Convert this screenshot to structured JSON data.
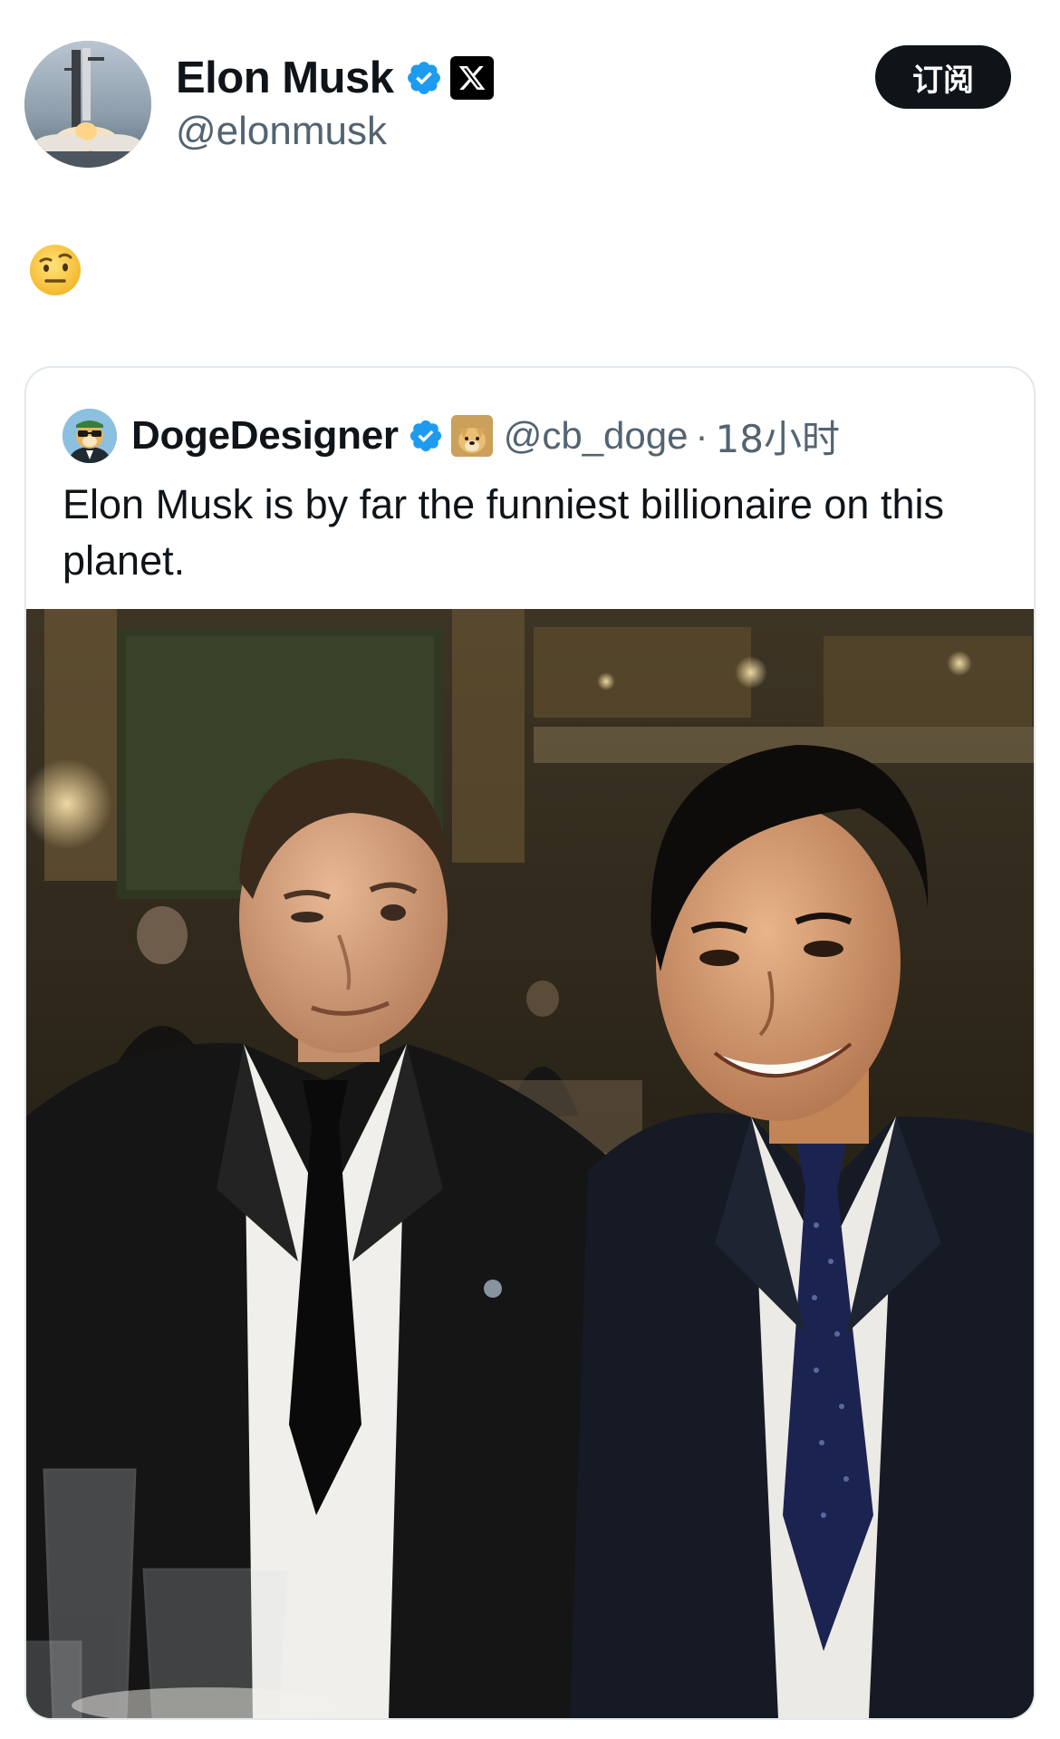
{
  "author": {
    "display_name": "Elon Musk",
    "handle": "@elonmusk",
    "avatar_icon": "rocket-launch-avatar",
    "verified_icon": "verified-badge-icon",
    "affiliate_icon": "x-logo-icon",
    "verified_color": "#1d9bf0"
  },
  "subscribe_button": {
    "label": "订阅"
  },
  "tweet": {
    "emoji_icon": "raised-eyebrow-emoji"
  },
  "quoted_tweet": {
    "display_name": "DogeDesigner",
    "handle": "@cb_doge",
    "separator": "·",
    "time": "18小时",
    "text": "Elon Musk is by far the funniest billionaire on this planet.",
    "avatar_icon": "doge-cartoon-avatar",
    "badge_icon": "doge-badge-icon",
    "photo_icon": "selfie-photo"
  },
  "colors": {
    "text": "#0f1419",
    "secondary_text": "#536471",
    "border": "#e1e8ed",
    "button_bg": "#0f1419"
  }
}
